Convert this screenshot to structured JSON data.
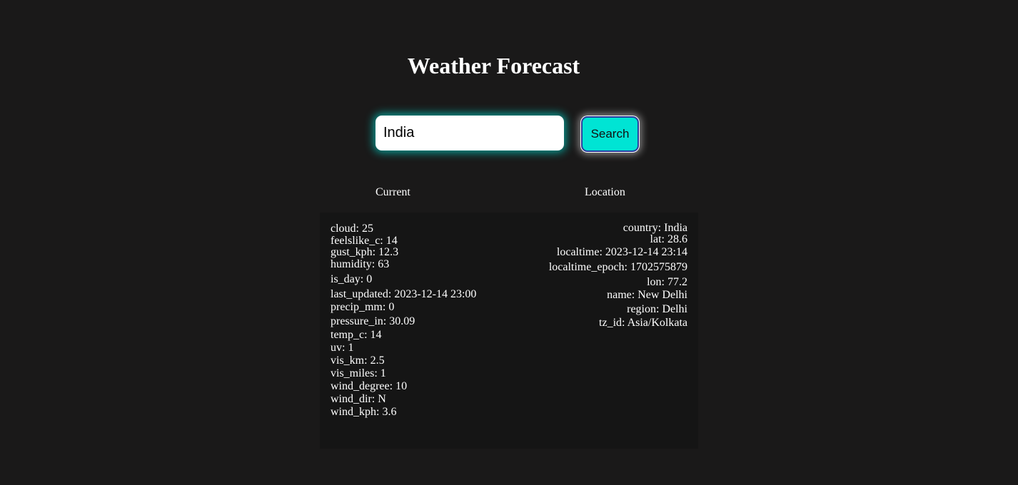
{
  "page": {
    "title": "Weather Forecast"
  },
  "search": {
    "value": "India",
    "button_label": "Search"
  },
  "sections": {
    "current_heading": "Current",
    "location_heading": "Location"
  },
  "current": [
    {
      "key": "cloud",
      "value": "25"
    },
    {
      "key": "feelslike_c",
      "value": "14"
    },
    {
      "key": "gust_kph",
      "value": "12.3"
    },
    {
      "key": "humidity",
      "value": "63"
    },
    {
      "key": "is_day",
      "value": "0"
    },
    {
      "key": "last_updated",
      "value": "2023-12-14 23:00"
    },
    {
      "key": "precip_mm",
      "value": "0"
    },
    {
      "key": "pressure_in",
      "value": "30.09"
    },
    {
      "key": "temp_c",
      "value": "14"
    },
    {
      "key": "uv",
      "value": "1"
    },
    {
      "key": "vis_km",
      "value": "2.5"
    },
    {
      "key": "vis_miles",
      "value": "1"
    },
    {
      "key": "wind_degree",
      "value": "10"
    },
    {
      "key": "wind_dir",
      "value": "N"
    },
    {
      "key": "wind_kph",
      "value": "3.6"
    }
  ],
  "location": [
    {
      "key": "country",
      "value": "India"
    },
    {
      "key": "lat",
      "value": "28.6"
    },
    {
      "key": "localtime",
      "value": "2023-12-14 23:14"
    },
    {
      "key": "localtime_epoch",
      "value": "1702575879"
    },
    {
      "key": "lon",
      "value": "77.2"
    },
    {
      "key": "name",
      "value": "New Delhi"
    },
    {
      "key": "region",
      "value": "Delhi"
    },
    {
      "key": "tz_id",
      "value": "Asia/Kolkata"
    }
  ],
  "colors": {
    "background": "#1a1919",
    "panel": "#151515",
    "accent": "#00e4d4",
    "button_border": "#2a3b9b",
    "text": "#ffffff"
  }
}
